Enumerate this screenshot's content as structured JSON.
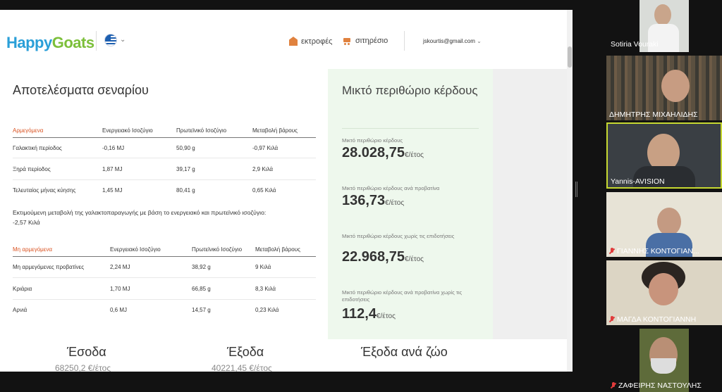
{
  "header": {
    "logo_part1": "Happy",
    "logo_part2": "Goats",
    "language_flag": "greek-flag-icon",
    "nav": [
      {
        "icon": "barn-icon",
        "label": "εκτροφές"
      },
      {
        "icon": "cart-icon",
        "label": "σιτηρέσιο"
      }
    ],
    "user_email": "jskourtis@gmail.com"
  },
  "results": {
    "title": "Αποτελέσματα σεναρίου",
    "milking": {
      "section_label": "Αρμεγόμενα",
      "columns": [
        "Ενεργειακό Ισοζύγιο",
        "Πρωτεϊνικό Ισοζύγιο",
        "Μεταβολή βάρους"
      ],
      "rows": [
        {
          "name": "Γαλακτική περίοδος",
          "energy": "-0,16 MJ",
          "protein": "50,90 g",
          "weight": "-0,97 Κιλά"
        },
        {
          "name": "Ξηρά περίοδος",
          "energy": "1,87 MJ",
          "protein": "39,17 g",
          "weight": "2,9 Κιλά"
        },
        {
          "name": "Τελευταίος μήνας κύησης",
          "energy": "1,45 MJ",
          "protein": "80,41 g",
          "weight": "0,65 Κιλά"
        }
      ]
    },
    "note_line1": "Εκτιμούμενη μεταβολή της γαλακτοπαραγωγής με βάση το ενεργειακό και πρωτεϊνικό ισοζύγιο:",
    "note_line2": "-2,57 Κιλά",
    "non_milking": {
      "section_label": "Μη αρμεγόμενα",
      "columns": [
        "Ενεργειακό Ισοζύγιο",
        "Πρωτεϊνικό Ισοζύγιο",
        "Μεταβολή βάρους"
      ],
      "rows": [
        {
          "name": "Μη αρμεγόμενες προβατίνες",
          "energy": "2,24 MJ",
          "protein": "38,92 g",
          "weight": "9 Κιλά"
        },
        {
          "name": "Κριάρια",
          "energy": "1,70 MJ",
          "protein": "66,85 g",
          "weight": "8,3 Κιλά"
        },
        {
          "name": "Αρνιά",
          "energy": "0,6 MJ",
          "protein": "14,57 g",
          "weight": "0,23 Κιλά"
        }
      ]
    }
  },
  "margin_panel": {
    "title": "Μικτό περιθώριο κέρδους",
    "items": [
      {
        "label": "Μικτό περιθώριο κέρδους",
        "value": "28.028,75",
        "unit": "€/έτος"
      },
      {
        "label": "Μικτό περιθώριο κέρδους ανά προβατίνα",
        "value": "136,73",
        "unit": "€/έτος"
      },
      {
        "label": "Μικτό περιθώριο κέρδους χωρίς τις επιδοτήσεις",
        "value": "22.968,75",
        "unit": "€/έτος"
      },
      {
        "label": "Μικτό περιθώριο κέρδους ανά προβατίνα χωρίς τις επιδοτήσεις",
        "value": "112,4",
        "unit": "€/έτος"
      }
    ]
  },
  "bottom": {
    "income_title": "Έσοδα",
    "income_value": "68250,2 €/έτος",
    "expense_title": "Έξοδα",
    "expense_value": "40221,45 €/έτος",
    "per_animal_title": "Έξοδα ανά ζώο"
  },
  "participants": [
    {
      "name": "Sotiria Vouraki",
      "muted": false
    },
    {
      "name": "ΔΗΜΗΤΡΗΣ ΜΙΧΑΗΛΙΔΗΣ",
      "muted": false
    },
    {
      "name": "Yannis-AVISION",
      "muted": false,
      "active": true
    },
    {
      "name": "ΓΙΑΝΝΗΣ ΚΟΝΤΟΓΙΑΝ...",
      "muted": true
    },
    {
      "name": "ΜΑΓΔΑ ΚΟΝΤΟΓΙΑΝΝΗ",
      "muted": true
    },
    {
      "name": "ΖΑΦΕΙΡΗΣ ΝΑΣΤΟΥΛΗΣ",
      "muted": true
    }
  ],
  "colors": {
    "accent_orange": "#d9501e",
    "green_panel": "#eef8ed",
    "active_speaker": "#c6d831"
  }
}
